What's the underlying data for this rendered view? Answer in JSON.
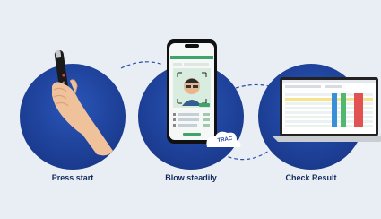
{
  "steps": [
    {
      "label": "Press start",
      "icon": "breathalyzer-hand-icon"
    },
    {
      "label": "Blow steadily",
      "icon": "smartphone-face-scan-icon"
    },
    {
      "label": "Check Result",
      "icon": "laptop-results-icon"
    }
  ],
  "phone": {
    "badge": "TRAC"
  },
  "colors": {
    "background": "#e9eef4",
    "circle": "#1d3f96",
    "caption": "#142a5c",
    "accent_green": "#3ea66b"
  }
}
